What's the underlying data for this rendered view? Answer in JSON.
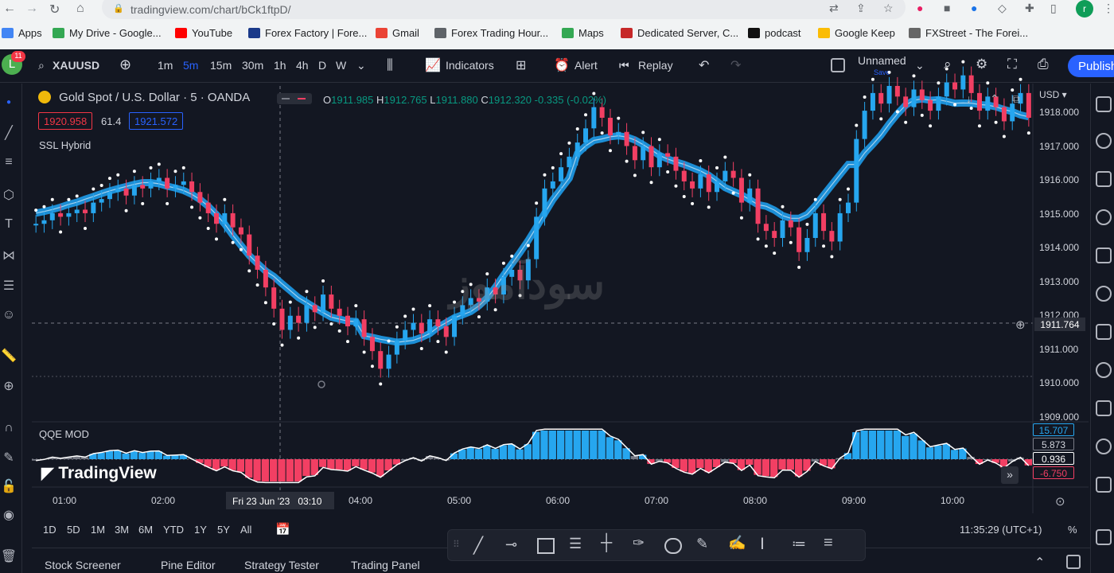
{
  "browser": {
    "url": "tradingview.com/chart/bCk1ftpD/",
    "bookmarks": [
      "Apps",
      "My Drive - Google...",
      "YouTube",
      "Forex Factory | Fore...",
      "Gmail",
      "Forex Trading Hour...",
      "Maps",
      "Dedicated Server, C...",
      "podcast",
      "Google Keep",
      "FXStreet - The Forei..."
    ],
    "bookmark_colors": [
      "#4285f4",
      "#34a853",
      "#ff0000",
      "#1a3a8a",
      "#ea4335",
      "#5f6368",
      "#34a853",
      "#c62828",
      "#111111",
      "#fbbc04",
      "#666666"
    ],
    "ext_badge": "11"
  },
  "toolbar": {
    "symbol": "XAUUSD",
    "intervals": [
      "1m",
      "5m",
      "15m",
      "30m",
      "1h",
      "4h",
      "D",
      "W"
    ],
    "active_interval": "5m",
    "indicators": "Indicators",
    "alert": "Alert",
    "replay": "Replay",
    "layout_name": "Unnamed",
    "layout_save": "Save",
    "publish": "Publish",
    "avatar": "L"
  },
  "legend": {
    "title": "Gold Spot / U.S. Dollar · 5 · OANDA",
    "ohlc": {
      "o_label": "O",
      "o": "1911.985",
      "h_label": "H",
      "h": "1912.765",
      "l_label": "L",
      "l": "1911.880",
      "c_label": "C",
      "c": "1912.320",
      "change": "-0.335 (-0.02%)"
    },
    "sell_price": "1920.958",
    "spread": "61.4",
    "buy_price": "1921.572",
    "indicator1": "SSL Hybrid",
    "indicator2": "QQE MOD"
  },
  "price_axis": {
    "currency": "USD",
    "labels": [
      "1918.000",
      "1917.000",
      "1916.000",
      "1915.000",
      "1914.000",
      "1913.000",
      "1912.000",
      "1911.000",
      "1910.000",
      "1909.000"
    ],
    "current_price": "1911.764"
  },
  "qqe_axis": {
    "v1": "15.707",
    "v2": "5.873",
    "v3": "0.936",
    "v4": "-6.750"
  },
  "time_axis": {
    "labels": [
      "01:00",
      "02:00",
      "03:10",
      "04:00",
      "05:00",
      "06:00",
      "07:00",
      "08:00",
      "09:00",
      "10:00"
    ],
    "crosshair": "Fri 23 Jun '23"
  },
  "ranges": [
    "1D",
    "5D",
    "1M",
    "3M",
    "6M",
    "YTD",
    "1Y",
    "5Y",
    "All"
  ],
  "clock": "11:35:29 (UTC+1)",
  "percent": "%",
  "bottom_tabs": [
    "Stock Screener",
    "Pine Editor",
    "Strategy Tester",
    "Trading Panel"
  ],
  "brand": "TradingView",
  "watermark": "سودآموز",
  "colors": {
    "up": "#26a6ef",
    "down": "#f23f63",
    "bg": "#131722",
    "ssl_up": "#1e9be9",
    "ssl_down": "#ff2e62",
    "grid": "#2a2e39"
  },
  "chart_data": {
    "type": "candlestick",
    "y_range": [
      1909,
      1918.5
    ],
    "candles_close": [
      1914.6,
      1914.7,
      1914.9,
      1914.8,
      1914.9,
      1915.0,
      1914.9,
      1915.2,
      1915.3,
      1915.5,
      1915.6,
      1915.4,
      1915.7,
      1915.6,
      1915.8,
      1915.9,
      1915.6,
      1915.7,
      1915.8,
      1915.5,
      1915.2,
      1914.9,
      1914.6,
      1914.9,
      1914.5,
      1914.3,
      1913.7,
      1913.3,
      1912.8,
      1912.2,
      1911.6,
      1912.0,
      1911.8,
      1912.3,
      1912.1,
      1912.6,
      1912.2,
      1912.0,
      1911.7,
      1911.9,
      1911.4,
      1911.0,
      1910.5,
      1910.9,
      1911.3,
      1911.6,
      1911.8,
      1911.5,
      1911.9,
      1911.7,
      1911.4,
      1912.0,
      1912.3,
      1912.5,
      1912.4,
      1912.8,
      1912.6,
      1913.1,
      1913.3,
      1913.0,
      1913.6,
      1914.8,
      1915.6,
      1915.8,
      1916.2,
      1916.5,
      1916.9,
      1917.3,
      1917.9,
      1917.6,
      1917.1,
      1917.2,
      1916.8,
      1916.4,
      1916.8,
      1916.2,
      1916.6,
      1916.5,
      1916.1,
      1915.8,
      1915.6,
      1916.0,
      1915.5,
      1915.8,
      1916.1,
      1915.9,
      1915.2,
      1915.6,
      1914.6,
      1914.4,
      1914.2,
      1914.7,
      1914.5,
      1913.8,
      1914.2,
      1914.9,
      1914.4,
      1914.1,
      1914.9,
      1915.2,
      1917.0,
      1917.8,
      1918.3,
      1918.0,
      1918.5,
      1918.2,
      1917.9,
      1918.4,
      1918.1,
      1917.8,
      1918.2,
      1918.6,
      1918.4,
      1918.8,
      1918.3,
      1917.8,
      1918.2,
      1917.9,
      1917.5,
      1918.0,
      1918.3,
      1917.6
    ]
  }
}
